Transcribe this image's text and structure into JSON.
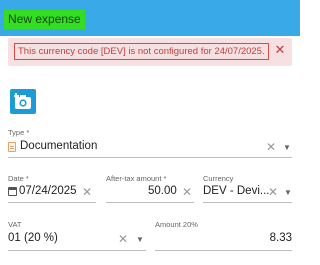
{
  "header": {
    "title": "New expense"
  },
  "alert": {
    "message": "This currency code [DEV] is not configured for 24/07/2025.",
    "close_label": "✕"
  },
  "form": {
    "type": {
      "label": "Type *",
      "value": "Documentation"
    },
    "date": {
      "label": "Date *",
      "value": "07/24/2025"
    },
    "after_tax_amount": {
      "label": "After-tax amount *",
      "value": "50.00"
    },
    "currency": {
      "label": "Currency",
      "value": "DEV - Devi..."
    },
    "vat": {
      "label": "VAT",
      "value": "01 (20 %)"
    },
    "amount_20": {
      "label": "Amount 20%",
      "value": "8.33"
    }
  },
  "icons": {
    "clear": "✕",
    "dropdown": "▼"
  },
  "colors": {
    "header": "#3aa9e8",
    "alert_bg": "#f6e0e1",
    "alert_text": "#c0413f",
    "camera_button": "#1d9bd7"
  }
}
